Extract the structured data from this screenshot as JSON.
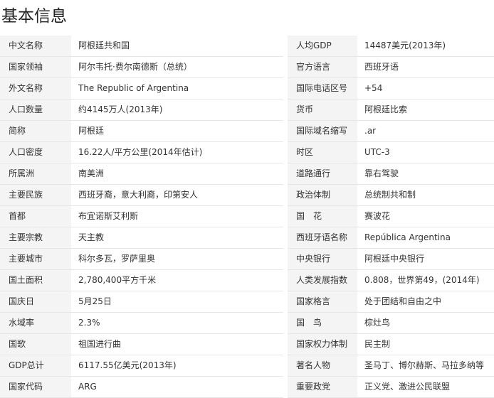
{
  "page": {
    "title": "基本信息"
  },
  "rows": [
    {
      "left": {
        "label": "中文名称",
        "value": "阿根廷共和国"
      },
      "right": {
        "label": "人均GDP",
        "value": "14487美元(2013年)"
      }
    },
    {
      "left": {
        "label": "国家领袖",
        "value": "阿尔韦托·费尔南德斯（总统）"
      },
      "right": {
        "label": "官方语言",
        "value": "西班牙语"
      }
    },
    {
      "left": {
        "label": "外文名称",
        "value": "The Republic of Argentina"
      },
      "right": {
        "label": "国际电话区号",
        "value": "+54"
      }
    },
    {
      "left": {
        "label": "人口数量",
        "value": "约4145万人(2013年)"
      },
      "right": {
        "label": "货币",
        "value": "阿根廷比索"
      }
    },
    {
      "left": {
        "label": "简称",
        "value": "阿根廷"
      },
      "right": {
        "label": "国际域名缩写",
        "value": ".ar"
      }
    },
    {
      "left": {
        "label": "人口密度",
        "value": "16.22人/平方公里(2014年估计)"
      },
      "right": {
        "label": "时区",
        "value": "UTC-3"
      }
    },
    {
      "left": {
        "label": "所属洲",
        "value": "南美洲"
      },
      "right": {
        "label": "道路通行",
        "value": "靠右驾驶"
      }
    },
    {
      "left": {
        "label": "主要民族",
        "value": "西班牙裔，意大利裔，印第安人"
      },
      "right": {
        "label": "政治体制",
        "value": "总统制共和制"
      }
    },
    {
      "left": {
        "label": "首都",
        "value": "布宜诺斯艾利斯"
      },
      "right": {
        "label": "国　花",
        "value": "赛波花"
      }
    },
    {
      "left": {
        "label": "主要宗教",
        "value": "天主教"
      },
      "right": {
        "label": "西班牙语名称",
        "value": "República Argentina"
      }
    },
    {
      "left": {
        "label": "主要城市",
        "value": "科尔多瓦，罗萨里奥"
      },
      "right": {
        "label": "中央银行",
        "value": "阿根廷中央银行"
      }
    },
    {
      "left": {
        "label": "国土面积",
        "value": "2,780,400平方千米"
      },
      "right": {
        "label": "人类发展指数",
        "value": "0.808，世界第49，(2014年)"
      }
    },
    {
      "left": {
        "label": "国庆日",
        "value": "5月25日"
      },
      "right": {
        "label": "国家格言",
        "value": "处于团结和自由之中"
      }
    },
    {
      "left": {
        "label": "水域率",
        "value": "2.3%"
      },
      "right": {
        "label": "国　鸟",
        "value": "棕灶鸟"
      }
    },
    {
      "left": {
        "label": "国歌",
        "value": "祖国进行曲"
      },
      "right": {
        "label": "国家权力体制",
        "value": "民主制"
      }
    },
    {
      "left": {
        "label": "GDP总计",
        "value": "6117.55亿美元(2013年)"
      },
      "right": {
        "label": "著名人物",
        "value": "圣马丁、博尔赫斯、马拉多纳等"
      }
    },
    {
      "left": {
        "label": "国家代码",
        "value": "ARG"
      },
      "right": {
        "label": "重要政党",
        "value": "正义党、激进公民联盟"
      }
    }
  ]
}
